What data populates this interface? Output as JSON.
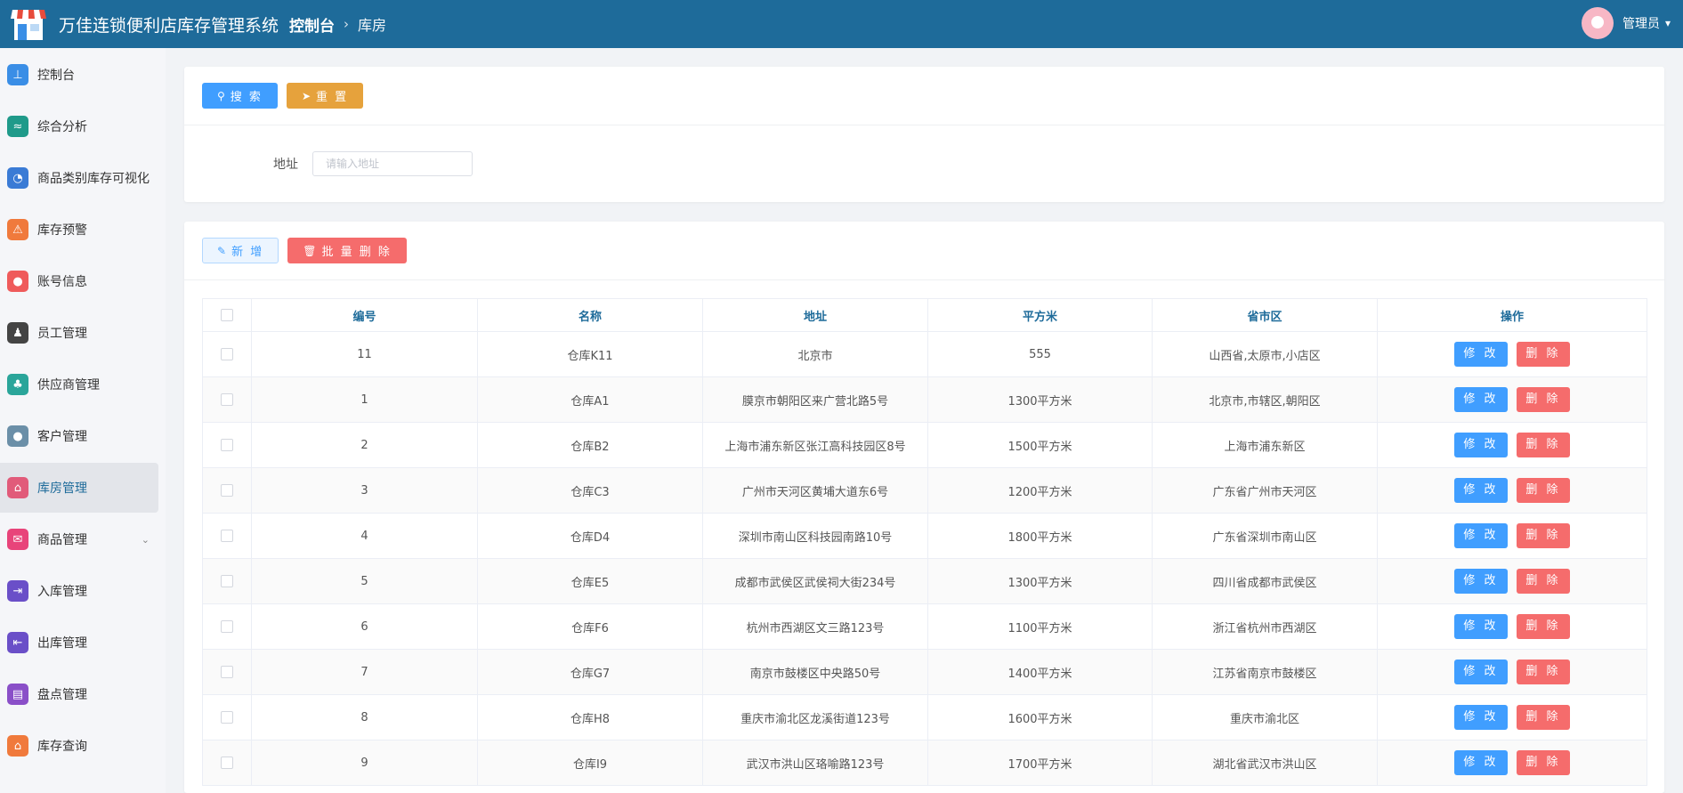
{
  "header": {
    "title": "万佳连锁便利店库存管理系统",
    "breadcrumb_home": "控制台",
    "breadcrumb_current": "库房",
    "user_name": "管理员"
  },
  "sidebar": {
    "items": [
      {
        "label": "控制台",
        "icon": "dashboard-icon",
        "color": "#3a8ee6"
      },
      {
        "label": "综合分析",
        "icon": "analytics-icon",
        "color": "#1f9a8a"
      },
      {
        "label": "商品类别库存可视化",
        "icon": "pie-chart-icon",
        "color": "#3a7bd5"
      },
      {
        "label": "库存预警",
        "icon": "warning-house-icon",
        "color": "#f07a3c"
      },
      {
        "label": "账号信息",
        "icon": "account-icon",
        "color": "#ef5b5b"
      },
      {
        "label": "员工管理",
        "icon": "employee-icon",
        "color": "#444444"
      },
      {
        "label": "供应商管理",
        "icon": "supplier-icon",
        "color": "#2aa59a"
      },
      {
        "label": "客户管理",
        "icon": "customer-icon",
        "color": "#6b8fa8"
      },
      {
        "label": "库房管理",
        "icon": "warehouse-icon",
        "color": "#e15b7a"
      },
      {
        "label": "商品管理",
        "icon": "goods-icon",
        "color": "#e8447a"
      },
      {
        "label": "入库管理",
        "icon": "inbound-icon",
        "color": "#6a4fc8"
      },
      {
        "label": "出库管理",
        "icon": "outbound-icon",
        "color": "#6a4fc8"
      },
      {
        "label": "盘点管理",
        "icon": "inventory-check-icon",
        "color": "#8a4fc8"
      },
      {
        "label": "库存查询",
        "icon": "stock-query-icon",
        "color": "#f07a3c"
      }
    ]
  },
  "search": {
    "search_label": "搜 索",
    "reset_label": "重 置",
    "address_label": "地址",
    "address_placeholder": "请输入地址"
  },
  "toolbar": {
    "add_label": "新 增",
    "batch_delete_label": "批 量 删 除"
  },
  "table": {
    "headers": [
      "编号",
      "名称",
      "地址",
      "平方米",
      "省市区",
      "操作"
    ],
    "edit_label": "修 改",
    "delete_label": "删 除",
    "rows": [
      [
        "11",
        "仓库K11",
        "北京市",
        "555",
        "山西省,太原市,小店区"
      ],
      [
        "1",
        "仓库A1",
        "膜京市朝阳区来广营北路5号",
        "1300平方米",
        "北京市,市辖区,朝阳区"
      ],
      [
        "2",
        "仓库B2",
        "上海市浦东新区张江高科技园区8号",
        "1500平方米",
        "上海市浦东新区"
      ],
      [
        "3",
        "仓库C3",
        "广州市天河区黄埔大道东6号",
        "1200平方米",
        "广东省广州市天河区"
      ],
      [
        "4",
        "仓库D4",
        "深圳市南山区科技园南路10号",
        "1800平方米",
        "广东省深圳市南山区"
      ],
      [
        "5",
        "仓库E5",
        "成都市武侯区武侯祠大街234号",
        "1300平方米",
        "四川省成都市武侯区"
      ],
      [
        "6",
        "仓库F6",
        "杭州市西湖区文三路123号",
        "1100平方米",
        "浙江省杭州市西湖区"
      ],
      [
        "7",
        "仓库G7",
        "南京市鼓楼区中央路50号",
        "1400平方米",
        "江苏省南京市鼓楼区"
      ],
      [
        "8",
        "仓库H8",
        "重庆市渝北区龙溪街道123号",
        "1600平方米",
        "重庆市渝北区"
      ],
      [
        "9",
        "仓库I9",
        "武汉市洪山区珞喻路123号",
        "1700平方米",
        "湖北省武汉市洪山区"
      ]
    ]
  }
}
